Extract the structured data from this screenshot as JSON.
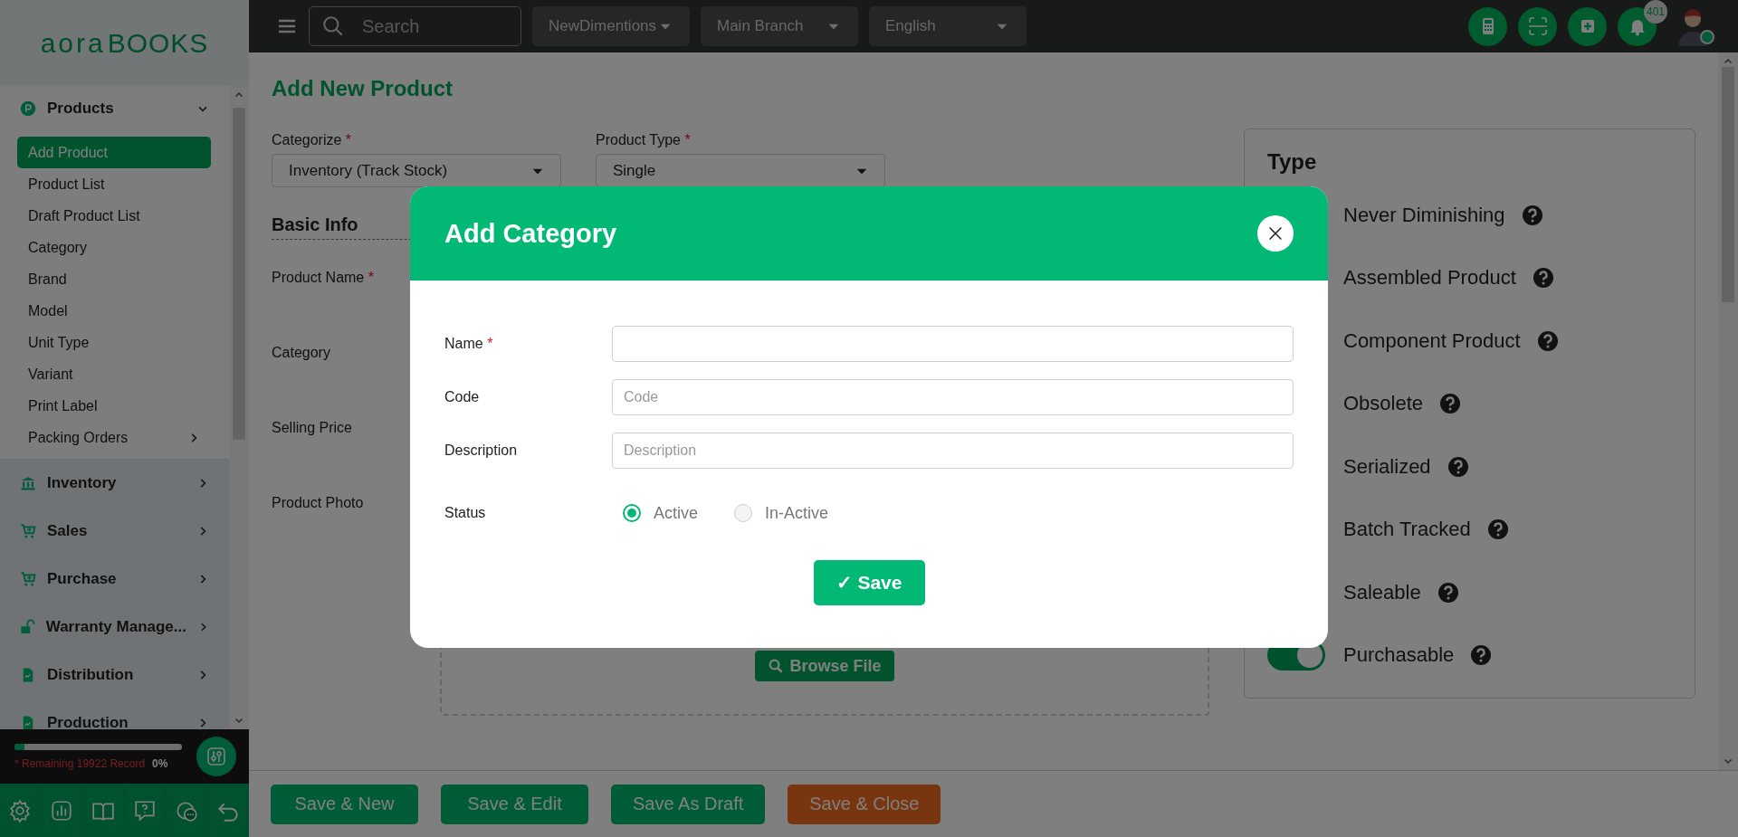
{
  "sidebar": {
    "logo": {
      "part_1": "aora",
      "part_2": "BOOKS"
    },
    "menu": [
      {
        "label": "Products",
        "expanded": true,
        "children": [
          {
            "label": "Add Product",
            "selected": true
          },
          {
            "label": "Product List",
            "selected": false
          },
          {
            "label": "Draft Product List",
            "selected": false
          },
          {
            "label": "Category",
            "selected": false
          },
          {
            "label": "Brand",
            "selected": false
          },
          {
            "label": "Model",
            "selected": false
          },
          {
            "label": "Unit Type",
            "selected": false
          },
          {
            "label": "Variant",
            "selected": false
          },
          {
            "label": "Print Label",
            "selected": false
          },
          {
            "label": "Packing Orders",
            "selected": false,
            "has_submenu": true
          }
        ]
      },
      {
        "label": "Inventory",
        "expanded": false
      },
      {
        "label": "Sales",
        "expanded": false
      },
      {
        "label": "Purchase",
        "expanded": false
      },
      {
        "label": "Warranty Manage...",
        "expanded": false
      },
      {
        "label": "Distribution",
        "expanded": false
      },
      {
        "label": "Production",
        "expanded": false
      }
    ],
    "usage": {
      "level": 0.06,
      "remaining": "* Remaining 19922 Record",
      "percent": "0%"
    }
  },
  "topbar": {
    "search": {
      "placeholder": "Search"
    },
    "selects": [
      {
        "value": "NewDimentions"
      },
      {
        "value": "Main Branch"
      },
      {
        "value": "English"
      }
    ],
    "notifications": "401"
  },
  "page": {
    "title": "Add New Product",
    "selects": [
      {
        "label": "Categorize",
        "required_mark": "*",
        "value": "Inventory (Track Stock)"
      },
      {
        "label": "Product Type",
        "required_mark": "*",
        "value": "Single"
      }
    ],
    "section": "Basic Info",
    "fields": [
      {
        "label": "Product Name",
        "required_mark": "*"
      },
      {
        "label": "Category"
      },
      {
        "label": "Selling Price"
      },
      {
        "label": "Product Photo"
      }
    ],
    "browse_button": "Browse File"
  },
  "type_panel": {
    "title": "Type",
    "options": [
      {
        "label": "Never Diminishing"
      },
      {
        "label": "Assembled Product"
      },
      {
        "label": "Component Product"
      },
      {
        "label": "Obsolete"
      },
      {
        "label": "Serialized"
      },
      {
        "label": "Batch Tracked"
      },
      {
        "label": "Saleable"
      },
      {
        "label": "Purchasable",
        "on": true
      }
    ]
  },
  "actions": [
    {
      "label": "Save & New",
      "kind": "primary"
    },
    {
      "label": "Save & Edit",
      "kind": "primary"
    },
    {
      "label": "Save As Draft",
      "kind": "primary"
    },
    {
      "label": "Save & Close",
      "kind": "warning"
    }
  ],
  "modal": {
    "title": "Add Category",
    "fields": [
      {
        "label": "Name",
        "required_mark": "*"
      },
      {
        "label": "Code",
        "placeholder": "Code"
      },
      {
        "label": "Description",
        "placeholder": "Description"
      }
    ],
    "status": {
      "label": "Status",
      "options": [
        {
          "label": "Active",
          "selected": true
        },
        {
          "label": "In-Active",
          "selected": false
        }
      ]
    },
    "save": "✓ Save"
  }
}
